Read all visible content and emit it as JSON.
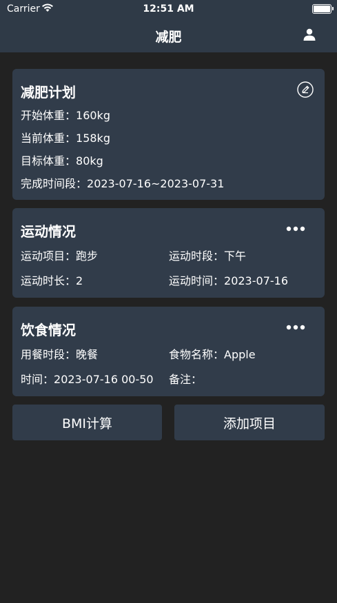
{
  "status_bar": {
    "carrier": "Carrier",
    "time": "12:51 AM"
  },
  "nav": {
    "title": "减肥",
    "user_icon": "person-icon"
  },
  "plan_card": {
    "title": "减肥计划",
    "edit_icon": "pencil-circle-icon",
    "rows": [
      {
        "label": "开始体重：",
        "value": "160kg"
      },
      {
        "label": "当前体重：",
        "value": "158kg"
      },
      {
        "label": "目标体重：",
        "value": "80kg"
      },
      {
        "label": "完成时间段：",
        "value": "2023-07-16~2023-07-31"
      }
    ]
  },
  "exercise_card": {
    "title": "运动情况",
    "more_icon": "ellipsis-icon",
    "item_label": "运动项目：",
    "item_value": "跑步",
    "period_label": "运动时段：",
    "period_value": "下午",
    "duration_label": "运动时长：",
    "duration_value": "2",
    "date_label": "运动时间：",
    "date_value": "2023-07-16"
  },
  "diet_card": {
    "title": "饮食情况",
    "more_icon": "ellipsis-icon",
    "meal_label": "用餐时段：",
    "meal_value": "晚餐",
    "food_label": "食物名称：",
    "food_value": "Apple",
    "time_label": "时间：",
    "time_value": "2023-07-16 00-50",
    "note_label": "备注：",
    "note_value": ""
  },
  "buttons": {
    "bmi": "BMI计算",
    "add": "添加项目"
  },
  "colors": {
    "background": "#222222",
    "card": "#313c4a",
    "bar": "#2f3a47",
    "text": "#ffffff"
  }
}
